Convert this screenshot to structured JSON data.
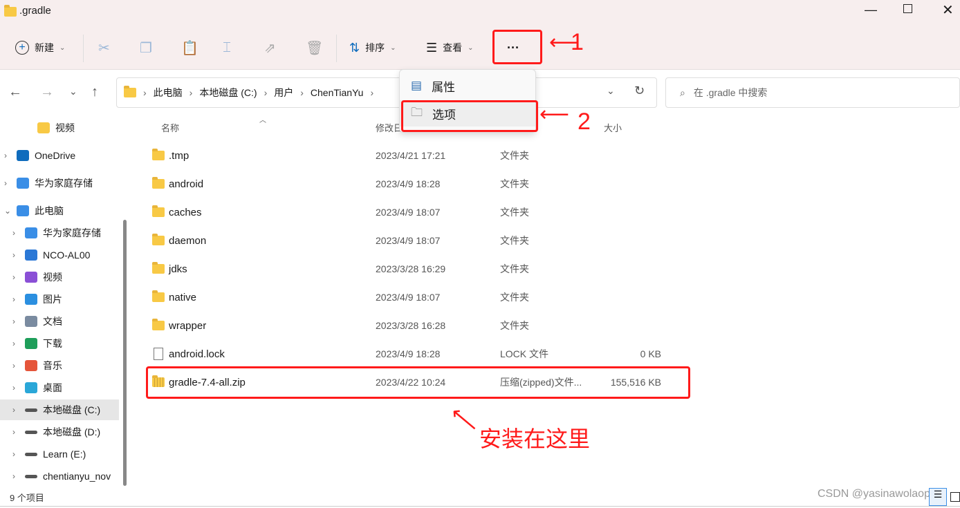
{
  "window": {
    "title": ".gradle",
    "controls": [
      "minimize",
      "maximize",
      "close"
    ]
  },
  "toolbar": {
    "new_label": "新建",
    "sort_label": "排序",
    "view_label": "查看",
    "more_label": "···"
  },
  "nav": {
    "back": "←",
    "forward": "→",
    "recent": "⌄",
    "up": "↑"
  },
  "breadcrumb": [
    "此电脑",
    "本地磁盘 (C:)",
    "用户",
    "ChenTianYu"
  ],
  "search": {
    "placeholder": "在 .gradle 中搜索"
  },
  "menu": {
    "items": [
      {
        "label": "属性",
        "icon": "properties-icon"
      },
      {
        "label": "选项",
        "icon": "folder-options-icon"
      }
    ]
  },
  "sidebar": {
    "items": [
      {
        "label": "视频",
        "icon": "folder-icon",
        "color": "#f8c945",
        "indent": 1,
        "arrow": false
      },
      {
        "label": "OneDrive",
        "icon": "cloud-icon",
        "color": "#0f6cbd",
        "indent": 0,
        "arrow": true
      },
      {
        "label": "华为家庭存储",
        "icon": "home-storage-icon",
        "color": "#3a8ee6",
        "indent": 0,
        "arrow": true
      },
      {
        "label": "此电脑",
        "icon": "computer-icon",
        "color": "#3a8ee6",
        "indent": 0,
        "arrow": true,
        "expanded": true
      },
      {
        "label": "华为家庭存储",
        "icon": "home-storage-icon",
        "color": "#3a8ee6",
        "indent": 1,
        "arrow": true
      },
      {
        "label": "NCO-AL00",
        "icon": "phone-icon",
        "color": "#2b78d6",
        "indent": 1,
        "arrow": true
      },
      {
        "label": "视频",
        "icon": "video-icon",
        "color": "#8a4fd6",
        "indent": 1,
        "arrow": true
      },
      {
        "label": "图片",
        "icon": "picture-icon",
        "color": "#2b8fe0",
        "indent": 1,
        "arrow": true
      },
      {
        "label": "文档",
        "icon": "document-icon",
        "color": "#7a8ba0",
        "indent": 1,
        "arrow": true
      },
      {
        "label": "下载",
        "icon": "download-icon",
        "color": "#1e9e5a",
        "indent": 1,
        "arrow": true
      },
      {
        "label": "音乐",
        "icon": "music-icon",
        "color": "#e5553a",
        "indent": 1,
        "arrow": true
      },
      {
        "label": "桌面",
        "icon": "desktop-icon",
        "color": "#2aa7d8",
        "indent": 1,
        "arrow": true
      },
      {
        "label": "本地磁盘 (C:)",
        "icon": "drive-icon",
        "color": "#555555",
        "indent": 1,
        "arrow": true,
        "selected": true
      },
      {
        "label": "本地磁盘 (D:)",
        "icon": "drive-icon",
        "color": "#555555",
        "indent": 1,
        "arrow": true
      },
      {
        "label": "Learn (E:)",
        "icon": "drive-icon",
        "color": "#555555",
        "indent": 1,
        "arrow": true
      },
      {
        "label": "chentianyu_nov",
        "icon": "drive-icon",
        "color": "#555555",
        "indent": 1,
        "arrow": true
      }
    ]
  },
  "columns": {
    "name": "名称",
    "modified": "修改日",
    "size": "大小"
  },
  "files": [
    {
      "name": ".tmp",
      "date": "2023/4/21 17:21",
      "type": "文件夹",
      "size": "",
      "kind": "folder"
    },
    {
      "name": "android",
      "date": "2023/4/9 18:28",
      "type": "文件夹",
      "size": "",
      "kind": "folder"
    },
    {
      "name": "caches",
      "date": "2023/4/9 18:07",
      "type": "文件夹",
      "size": "",
      "kind": "folder"
    },
    {
      "name": "daemon",
      "date": "2023/4/9 18:07",
      "type": "文件夹",
      "size": "",
      "kind": "folder"
    },
    {
      "name": "jdks",
      "date": "2023/3/28 16:29",
      "type": "文件夹",
      "size": "",
      "kind": "folder"
    },
    {
      "name": "native",
      "date": "2023/4/9 18:07",
      "type": "文件夹",
      "size": "",
      "kind": "folder"
    },
    {
      "name": "wrapper",
      "date": "2023/3/28 16:28",
      "type": "文件夹",
      "size": "",
      "kind": "folder"
    },
    {
      "name": "android.lock",
      "date": "2023/4/9 18:28",
      "type": "LOCK 文件",
      "size": "0 KB",
      "kind": "file"
    },
    {
      "name": "gradle-7.4-all.zip",
      "date": "2023/4/22 10:24",
      "type": "压缩(zipped)文件...",
      "size": "155,516 KB",
      "kind": "zip"
    }
  ],
  "status": {
    "count": "9 个项目"
  },
  "annotations": {
    "step1": "1",
    "step2": "2",
    "note": "安装在这里",
    "color": "#ff1a1a"
  },
  "watermark": "CSDN @yasinawolaopo"
}
